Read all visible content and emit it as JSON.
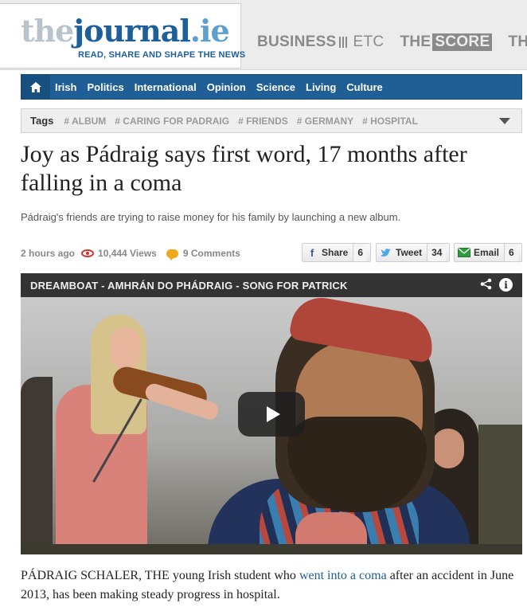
{
  "brand": {
    "logo_the": "the",
    "logo_journal": "journal",
    "logo_ie": ".ie",
    "tagline": "READ, SHARE AND SHAPE THE NEWS",
    "brand_color": "#1d5f9a"
  },
  "sister_sites": {
    "business": "BUSINESS",
    "etc": "ETC",
    "the": "THE",
    "score": "SCORE",
    "daily_edge": "THE DA"
  },
  "nav": {
    "home_icon": "home-icon",
    "items": [
      "Irish",
      "Politics",
      "International",
      "Opinion",
      "Science",
      "Living",
      "Culture"
    ]
  },
  "tags": {
    "label": "Tags",
    "items": [
      "# ALBUM",
      "# CARING FOR PADRAIG",
      "# FRIENDS",
      "# GERMANY",
      "# HOSPITAL"
    ],
    "toggle_icon": "chevron-down-icon"
  },
  "article": {
    "headline": "Joy as Pádraig says first word, 17 months after falling in a coma",
    "standfirst": "Pádraig's friends are trying to raise money for his family by launching a new album.",
    "time": "2 hours ago",
    "views": "10,444 Views",
    "comments": "9 Comments",
    "body_before_link": "PÁDRAIG SCHALER, THE young Irish student who ",
    "body_link": "went into a coma",
    "body_after_link": " after an accident in June 2013, has been making steady progress in hospital."
  },
  "share": {
    "facebook_label": "Share",
    "facebook_count": "6",
    "twitter_label": "Tweet",
    "twitter_count": "34",
    "email_label": "Email",
    "email_count": "6"
  },
  "video": {
    "title": "DREAMBOAT - AMHRÁN DO PHÁDRAIG - SONG FOR PATRICK"
  }
}
